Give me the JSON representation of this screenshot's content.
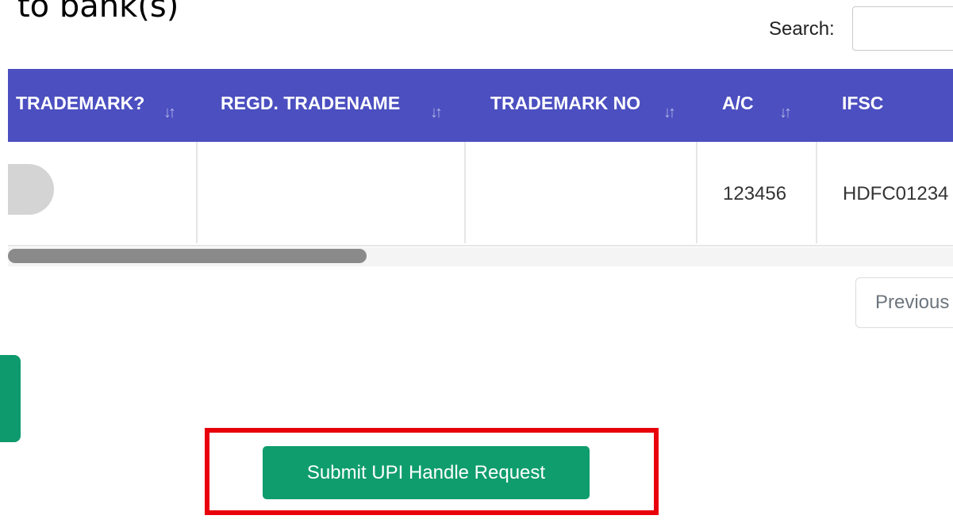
{
  "page": {
    "heading": "to bank(s)"
  },
  "search": {
    "label": "Search:",
    "value": ""
  },
  "table": {
    "columns": [
      {
        "label": "TRADEMARK?"
      },
      {
        "label": "REGD. TRADENAME"
      },
      {
        "label": "TRADEMARK NO"
      },
      {
        "label": "A/C"
      },
      {
        "label": "IFSC"
      }
    ],
    "rows": [
      {
        "trademark": "",
        "regd_tradename": "",
        "trademark_no": "",
        "ac": "123456",
        "ifsc": "HDFC01234"
      }
    ],
    "sort_icon": "sort-arrows-icon",
    "trademark_toggle_on": false
  },
  "pagination": {
    "previous_label": "Previous"
  },
  "submit": {
    "label": "Submit UPI Handle Request"
  },
  "colors": {
    "header_bg": "#4b4fc0",
    "primary_green": "#0f9d6e",
    "highlight_red": "#e8000b"
  }
}
